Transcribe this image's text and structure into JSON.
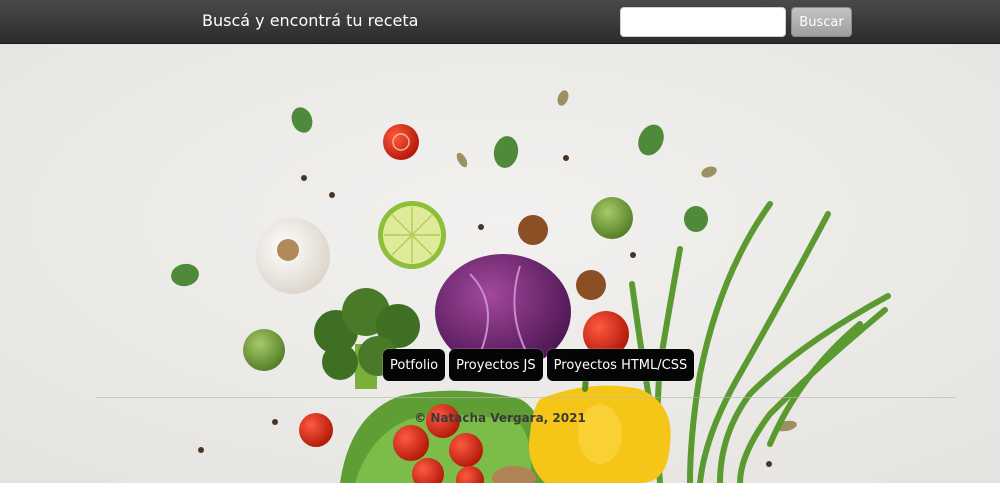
{
  "header": {
    "title": "Buscá y encontrá tu receta",
    "search_placeholder": "",
    "search_button_label": "Buscar"
  },
  "nav": {
    "items": [
      {
        "label": "Potfolio"
      },
      {
        "label": "Proyectos JS"
      },
      {
        "label": "Proyectos HTML/CSS"
      }
    ]
  },
  "footer": {
    "text": "© Natacha Vergara, 2021"
  },
  "colors": {
    "topbar": "#2f2f2f",
    "button": "#b0b0b0",
    "pill": "#050505",
    "background": "#ecebe8"
  }
}
